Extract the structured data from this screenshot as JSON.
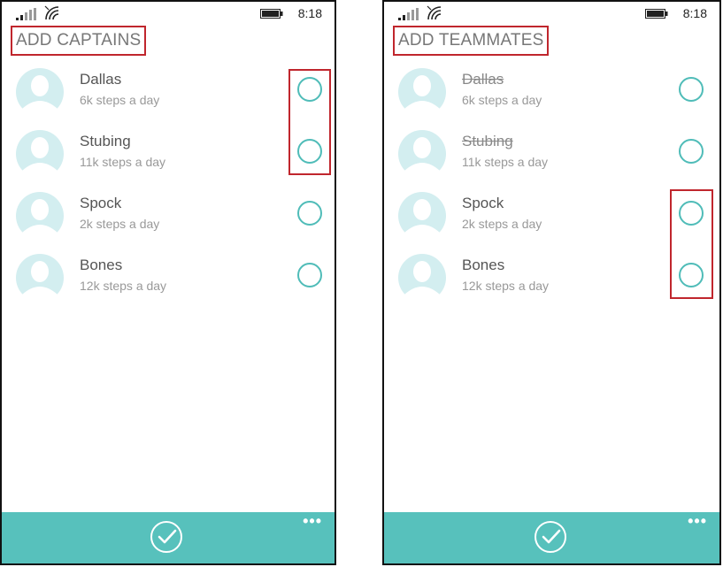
{
  "status": {
    "time": "8:18"
  },
  "screens": [
    {
      "title": "ADD CAPTAINS",
      "people": [
        {
          "name": "Dallas",
          "steps": "6k steps a day",
          "struck": false
        },
        {
          "name": "Stubing",
          "steps": "11k steps a day",
          "struck": false
        },
        {
          "name": "Spock",
          "steps": "2k steps a day",
          "struck": false
        },
        {
          "name": "Bones",
          "steps": "12k steps a day",
          "struck": false
        }
      ]
    },
    {
      "title": "ADD TEAMMATES",
      "people": [
        {
          "name": "Dallas",
          "steps": "6k steps a day",
          "struck": true
        },
        {
          "name": "Stubing",
          "steps": "11k steps a day",
          "struck": true
        },
        {
          "name": "Spock",
          "steps": "2k steps a day",
          "struck": false
        },
        {
          "name": "Bones",
          "steps": "12k steps a day",
          "struck": false
        }
      ]
    }
  ],
  "app_bar": {
    "more_label": "•••"
  },
  "icons": {
    "signal": "signal-strength-icon",
    "wifi": "wifi-icon",
    "battery": "battery-icon",
    "avatar": "person-avatar-icon",
    "confirm": "checkmark-icon",
    "more": "more-options-icon"
  },
  "colors": {
    "accent": "#57c1bc",
    "radio_border": "#4fbcb8",
    "avatar_bg": "#d3eef0",
    "highlight": "#c0262d"
  }
}
